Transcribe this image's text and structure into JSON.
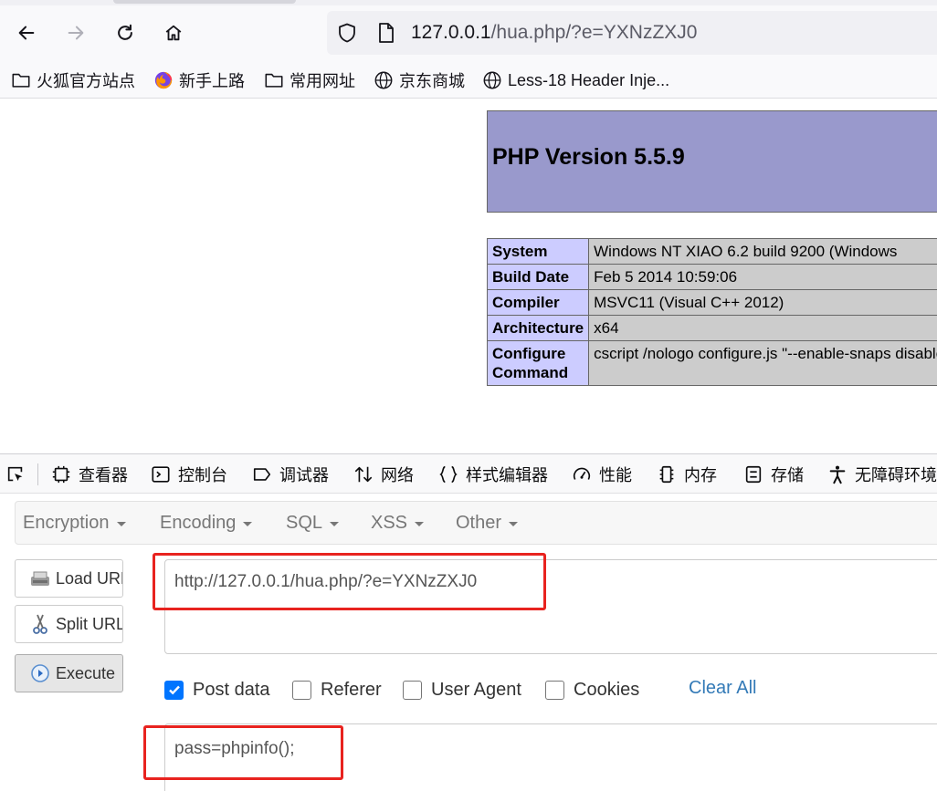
{
  "browser": {
    "nav": {
      "back_icon": "arrow-left-icon",
      "forward_icon": "arrow-right-icon",
      "reload_icon": "reload-icon",
      "home_icon": "home-icon"
    },
    "address": {
      "host": "127.0.0.1",
      "path": "/hua.php/?e=YXNzZXJ0"
    },
    "bookmarks": [
      {
        "label": "火狐官方站点",
        "icon": "folder-icon"
      },
      {
        "label": "新手上路",
        "icon": "firefox-icon"
      },
      {
        "label": "常用网址",
        "icon": "folder-icon"
      },
      {
        "label": "京东商城",
        "icon": "globe-icon"
      },
      {
        "label": "Less-18 Header Inje...",
        "icon": "globe-icon"
      }
    ]
  },
  "phpinfo": {
    "title": "PHP Version 5.5.9",
    "rows": [
      {
        "key": "System",
        "value": "Windows NT XIAO 6.2 build 9200 (Windows"
      },
      {
        "key": "Build Date",
        "value": "Feb 5 2014 10:59:06"
      },
      {
        "key": "Compiler",
        "value": "MSVC11 (Visual C++ 2012)"
      },
      {
        "key": "Architecture",
        "value": "x64"
      },
      {
        "key": "Configure\nCommand",
        "value": "cscript /nologo configure.js \"--enable-snaps\ndisable-isapi\" \"--disable-nsapi\" \"--without-m\nwith-pdo-oci=C:\\php-sdk\\oracle\\instantclient\nsdk\\oracle\\instantclient10\\sdk,shared\" \"--wit\nsdk\\oracle\\instantclient11\\sdk,shared\" \"--wit"
      }
    ]
  },
  "devtools": {
    "tabs": [
      {
        "label": "查看器",
        "icon": "inspector-icon"
      },
      {
        "label": "控制台",
        "icon": "console-icon"
      },
      {
        "label": "调试器",
        "icon": "debugger-icon"
      },
      {
        "label": "网络",
        "icon": "network-icon"
      },
      {
        "label": "样式编辑器",
        "icon": "style-editor-icon"
      },
      {
        "label": "性能",
        "icon": "performance-icon"
      },
      {
        "label": "内存",
        "icon": "memory-icon"
      },
      {
        "label": "存储",
        "icon": "storage-icon"
      },
      {
        "label": "无障碍环境",
        "icon": "accessibility-icon"
      }
    ]
  },
  "hackbar": {
    "menu": [
      "Encryption",
      "Encoding",
      "SQL",
      "XSS",
      "Other"
    ],
    "buttons": {
      "load": "Load URL",
      "split": "Split URL",
      "execute": "Execute"
    },
    "url_value": "http://127.0.0.1/hua.php/?e=YXNzZXJ0",
    "options": [
      {
        "label": "Post data",
        "checked": true
      },
      {
        "label": "Referer",
        "checked": false
      },
      {
        "label": "User Agent",
        "checked": false
      },
      {
        "label": "Cookies",
        "checked": false
      }
    ],
    "clear_all": "Clear All",
    "post_value": "pass=phpinfo();"
  },
  "colors": {
    "highlight": "#e8231f",
    "php_header": "#9999cc",
    "php_key": "#ccccff",
    "php_value": "#cccccc",
    "link": "#337ab7",
    "checkbox": "#0075ff"
  }
}
